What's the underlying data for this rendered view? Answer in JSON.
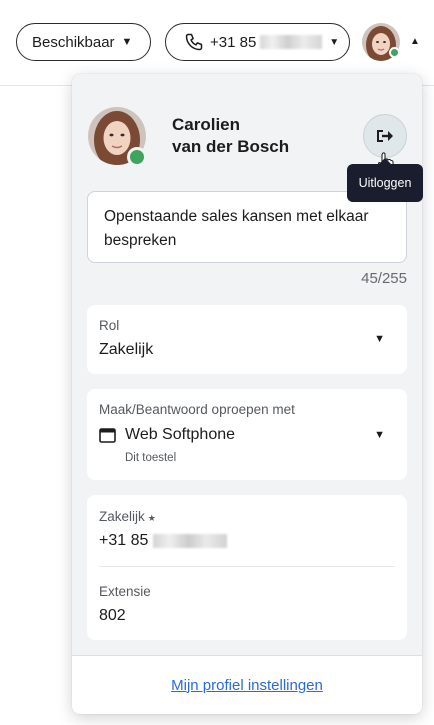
{
  "topbar": {
    "status_label": "Beschikbaar",
    "phone_prefix": "+31 85"
  },
  "profile": {
    "first_name": "Carolien",
    "last_name": "van der Bosch",
    "presence_color": "#3fa45c"
  },
  "logout": {
    "tooltip": "Uitloggen",
    "icon": "logout-icon"
  },
  "note": {
    "text": "Openstaande sales kansen met elkaar bespreken",
    "count": "45/255"
  },
  "role": {
    "label": "Rol",
    "value": "Zakelijk"
  },
  "calls": {
    "label": "Maak/Beantwoord oproepen met",
    "device": "Web Softphone",
    "sub": "Dit toestel"
  },
  "numbers": {
    "business_label": "Zakelijk",
    "business_prefix": "+31 85",
    "extension_label": "Extensie",
    "extension_value": "802"
  },
  "footer": {
    "link": "Mijn profiel instellingen"
  },
  "colors": {
    "accent_link": "#2a6bd8",
    "tooltip_bg": "#1a1d2e",
    "panel_bg": "#f2f3f5"
  }
}
